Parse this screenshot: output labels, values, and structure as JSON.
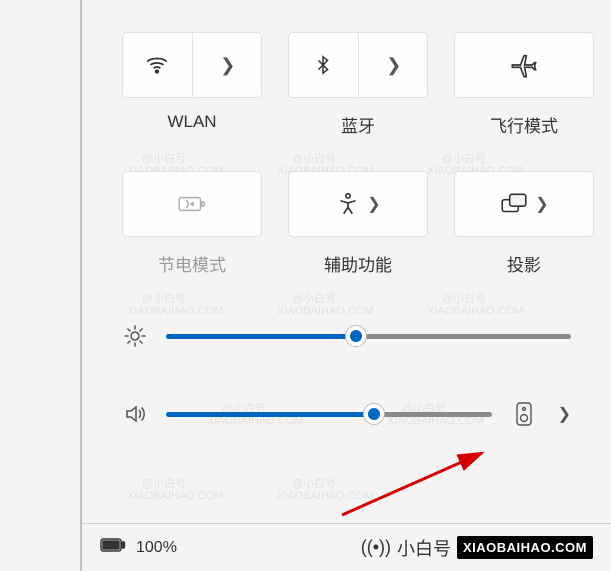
{
  "quick_settings": {
    "wlan": {
      "label": "WLAN",
      "icon": "wifi",
      "split": true,
      "disabled": false
    },
    "bluetooth": {
      "label": "蓝牙",
      "icon": "bluetooth",
      "split": true,
      "disabled": false
    },
    "airplane": {
      "label": "飞行模式",
      "icon": "airplane",
      "split": false,
      "disabled": false
    },
    "battery_saver": {
      "label": "节电模式",
      "icon": "battery-saver",
      "split": false,
      "disabled": true
    },
    "accessibility": {
      "label": "辅助功能",
      "icon": "accessibility",
      "split": false,
      "has_chevron": true,
      "disabled": false
    },
    "project": {
      "label": "投影",
      "icon": "project",
      "split": false,
      "has_chevron": true,
      "disabled": false
    }
  },
  "sliders": {
    "brightness": {
      "icon": "brightness",
      "value_percent": 47
    },
    "volume": {
      "icon": "volume",
      "value_percent": 64,
      "output_icon": "speaker-device",
      "has_chevron": true
    }
  },
  "status": {
    "battery_percent": "100%"
  },
  "branding": {
    "name": "小白号",
    "domain": "XIAOBAIHAO.COM"
  },
  "watermark": {
    "text_cn": "@小白号",
    "text_en": "XIAOBAIHAO.COM"
  },
  "colors": {
    "accent": "#0067c0"
  }
}
